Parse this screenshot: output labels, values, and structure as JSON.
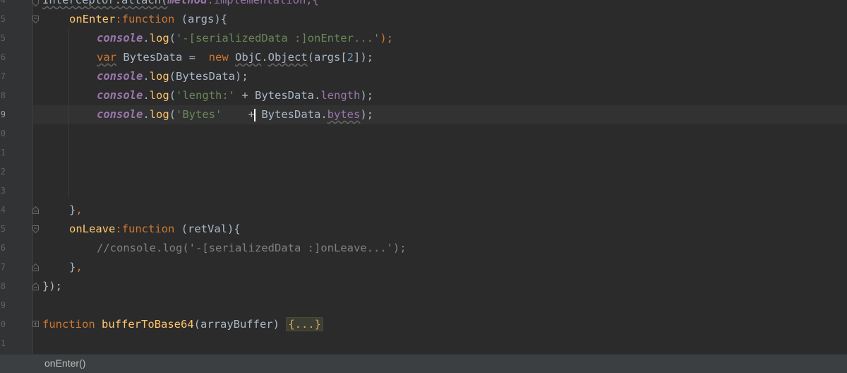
{
  "editor": {
    "line_numbers": [
      "4",
      "5",
      "5",
      "6",
      "7",
      "8",
      "9",
      "0",
      "1",
      "2",
      "3",
      "4",
      "5",
      "6",
      "7",
      "8",
      "9",
      "0",
      "1"
    ],
    "code": {
      "l0_a": "Interceptor.attach(",
      "l0_b": "method",
      "l0_c": ".implementation,{",
      "l1_name": "onEnter",
      "l1_colon": ":",
      "l1_kw": "function",
      "l1_rest": " (args){",
      "l2_console": "console",
      "l2_dot": ".",
      "l2_log": "log",
      "l2_open": "(",
      "l2_str": "'-[serializedData :]onEnter...'",
      "l2_close": ");",
      "l3_var": "var",
      "l3_rest": " BytesData =  ",
      "l3_new": "new",
      "l3_sp": " ",
      "l3_objc": "ObjC",
      "l3_dot": ".",
      "l3_object": "Object",
      "l3_args": "(args[",
      "l3_num": "2",
      "l3_end": "]);",
      "l4_console": "console",
      "l4_dot": ".",
      "l4_log": "log",
      "l4_rest": "(BytesData);",
      "l5_console": "console",
      "l5_dot": ".",
      "l5_log": "log",
      "l5_open": "(",
      "l5_str": "'length:'",
      "l5_mid": " + BytesData.",
      "l5_prop": "length",
      "l5_end": ");",
      "l6_console": "console",
      "l6_dot": ".",
      "l6_log": "log",
      "l6_open": "(",
      "l6_str": "'Bytes'",
      "l6_gap": "    +",
      "l6_mid": " BytesData.",
      "l6_prop": "bytes",
      "l6_end": ");",
      "l10_a": "}",
      "l10_b": ",",
      "l11_name": "onLeave",
      "l11_colon": ":",
      "l11_kw": "function",
      "l11_rest": " (retVal){",
      "l12_comment": "//console.log('-[serializedData :]onLeave...');",
      "l13_a": "}",
      "l13_b": ",",
      "l14_a": "});",
      "l16_kw": "function",
      "l16_sp": " ",
      "l16_name": "bufferToBase64",
      "l16_rest": "(arrayBuffer) ",
      "l16_fold": "{...}"
    }
  },
  "breadcrumb": {
    "label": "onEnter()"
  },
  "colors": {
    "background": "#2b2b2b",
    "gutter": "#313335",
    "keyword": "#cc7832",
    "function_name": "#ffc66d",
    "property": "#9876aa",
    "string": "#6a8759",
    "number": "#6897bb",
    "comment": "#808080"
  }
}
